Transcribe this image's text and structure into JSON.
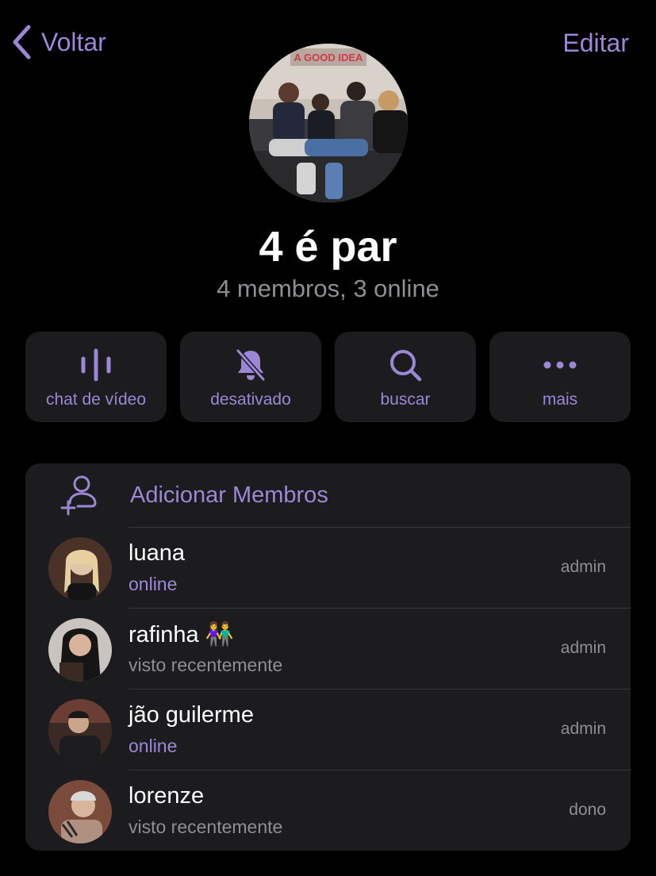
{
  "nav": {
    "back_label": "Voltar",
    "edit_label": "Editar"
  },
  "group": {
    "avatar_sign_text": "A GOOD IDEA",
    "title": "4 é par",
    "subtitle": "4 membros, 3 online"
  },
  "actions": [
    {
      "label": "chat de vídeo",
      "icon": "waveform-icon"
    },
    {
      "label": "desativado",
      "icon": "bell-slash-icon"
    },
    {
      "label": "buscar",
      "icon": "search-icon"
    },
    {
      "label": "mais",
      "icon": "more-icon"
    }
  ],
  "members_section": {
    "add_label": "Adicionar Membros",
    "members": [
      {
        "name": "luana",
        "status": "online",
        "role": "admin"
      },
      {
        "name": "rafinha 👫",
        "status": "visto recentemente",
        "role": "admin"
      },
      {
        "name": "jão guilerme",
        "status": "online",
        "role": "admin"
      },
      {
        "name": "lorenze",
        "status": "visto recentemente",
        "role": "dono"
      }
    ]
  },
  "colors": {
    "accent": "#9b87d6",
    "background": "#000000",
    "card": "#1c1c1e",
    "secondary_text": "#8e8e93"
  }
}
